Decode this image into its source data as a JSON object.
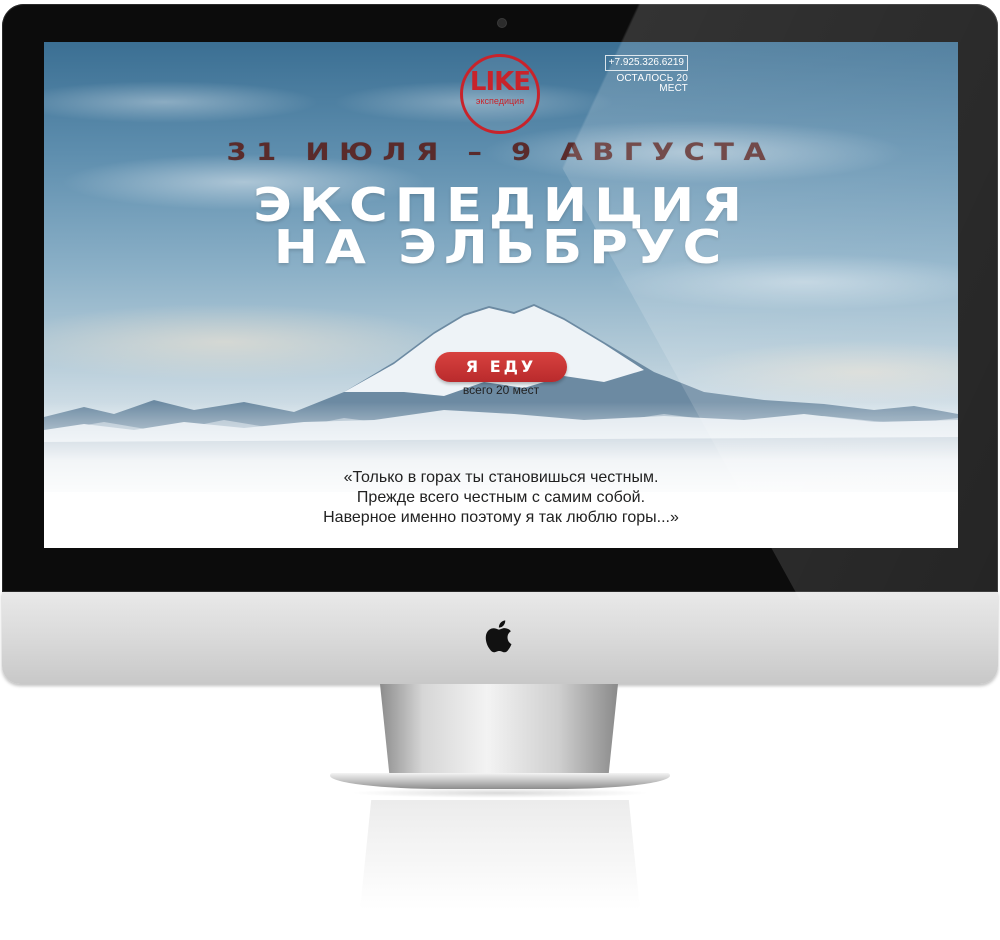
{
  "logo": {
    "word": "LIKE",
    "sub": "экспедиция"
  },
  "contact": {
    "phone": "+7.925.326.6219",
    "seats_left": "ОСТАЛОСЬ 20 МЕСТ"
  },
  "hero": {
    "dates": "31 ИЮЛЯ – 9 АВГУСТА",
    "title_line1": "ЭКСПЕДИЦИЯ",
    "title_line2": "НА ЭЛЬБРУС",
    "cta_label": "Я ЕДУ",
    "cta_note": "всего 20 мест"
  },
  "quote": {
    "line1": "«Только в горах ты становишься честным.",
    "line2": "Прежде всего честным с самим собой.",
    "line3": "Наверное  именно поэтому я так люблю горы...»"
  },
  "colors": {
    "accent": "#c8232b",
    "title": "#ffffff",
    "dates": "#5a2b2b"
  }
}
